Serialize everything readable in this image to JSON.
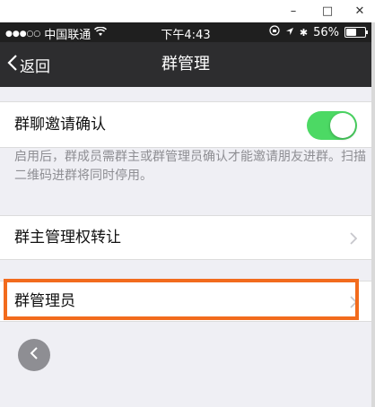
{
  "window": {
    "minimize_icon": "minimize-icon",
    "maximize_icon": "maximize-icon",
    "close_icon": "close-icon",
    "minimize": "–",
    "maximize": "□",
    "close": "✕"
  },
  "status_bar": {
    "signal": "●●●○○",
    "carrier": "中国联通",
    "time": "下午4:43",
    "battery": "56%",
    "battery_level": 0.56
  },
  "nav": {
    "back_label": "返回",
    "title": "群管理"
  },
  "settings": {
    "invite_confirm": {
      "label": "群聊邀请确认",
      "enabled": true
    },
    "invite_desc": "启用后，群成员需群主或群管理员确认才能邀请朋友进群。扫描二维码进群将同时停用。",
    "transfer_owner": {
      "label": "群主管理权转让"
    },
    "admins": {
      "label": "群管理员"
    }
  },
  "colors": {
    "accent_green": "#4cd964",
    "highlight": "#f26b1d",
    "nav_bg": "#2d2d2f"
  }
}
